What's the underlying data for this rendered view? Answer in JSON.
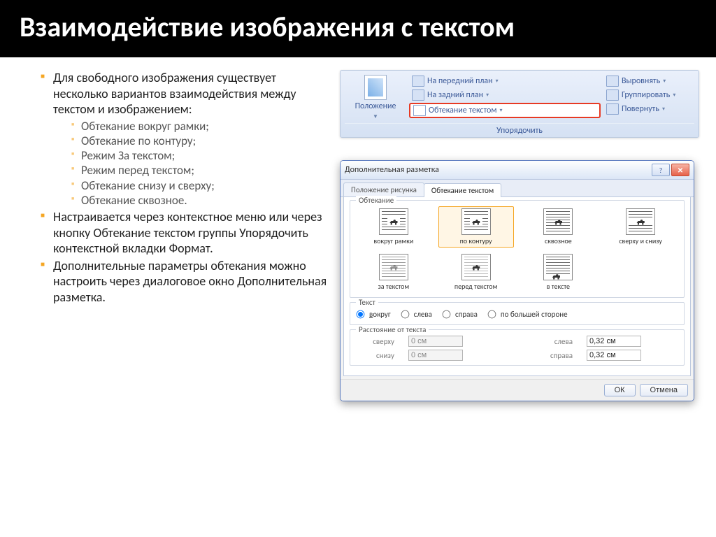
{
  "slide": {
    "title": "Взаимодействие изображения с текстом",
    "bullets": {
      "b1": "Для свободного изображения существует несколько вариантов взаимодействия между текстом и изображением:",
      "sub": [
        "Обтекание вокруг рамки;",
        "Обтекание по контуру;",
        "Режим За текстом;",
        "Режим перед текстом;",
        "Обтекание снизу и сверху;",
        "Обтекание сквозное."
      ],
      "b2": "Настраивается через контекстное меню или через кнопку Обтекание текстом группы Упорядочить контекстной вкладки Формат.",
      "b3": "Дополнительные параметры обтекания можно настроить через диалоговое окно Дополнительная разметка."
    }
  },
  "ribbon": {
    "position": "Положение",
    "bring_front": "На передний план",
    "send_back": "На задний план",
    "text_wrap": "Обтекание текстом",
    "align": "Выровнять",
    "group": "Группировать",
    "rotate": "Повернуть",
    "caption": "Упорядочить"
  },
  "dialog": {
    "title": "Дополнительная разметка",
    "tabs": {
      "pos": "Положение рисунка",
      "wrap": "Обтекание текстом"
    },
    "group_wrap": "Обтекание",
    "wrap_options": {
      "square": "вокруг рамки",
      "tight": "по контуру",
      "through": "сквозное",
      "topbot": "сверху и снизу",
      "behind": "за текстом",
      "front": "перед текстом",
      "inline": "в тексте"
    },
    "group_text": "Текст",
    "text_radios": {
      "around": "вокруг",
      "left": "слева",
      "right": "справа",
      "largest": "по большей стороне"
    },
    "group_dist": "Расстояние от текста",
    "dist": {
      "top_label": "сверху",
      "bottom_label": "снизу",
      "left_label": "слева",
      "right_label": "справа",
      "top": "0 см",
      "bottom": "0 см",
      "left": "0,32 см",
      "right": "0,32 см"
    },
    "ok": "ОК",
    "cancel": "Отмена"
  }
}
